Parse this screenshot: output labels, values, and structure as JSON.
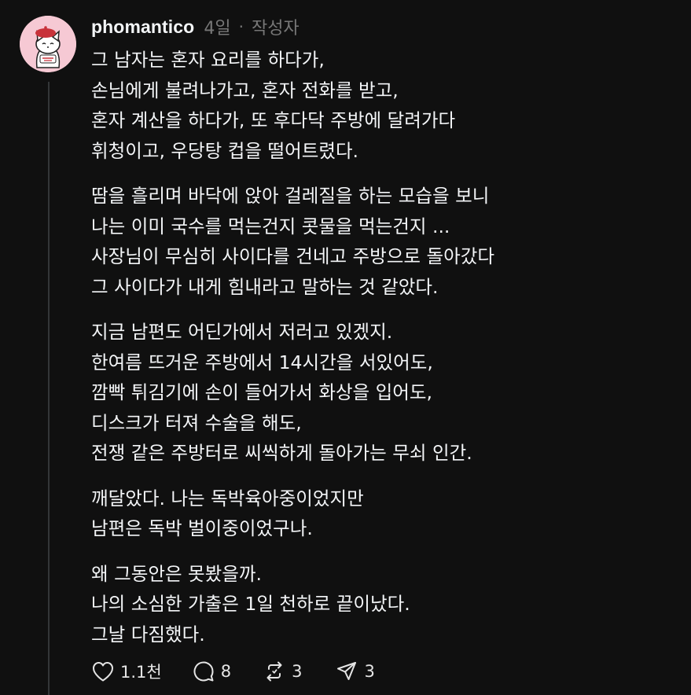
{
  "post": {
    "username": "phomantico",
    "time_ago": "4일",
    "separator": "·",
    "author_tag": "작성자",
    "avatar_icon": "cat-with-beret-avatar",
    "paragraphs": [
      {
        "lines": [
          "그 남자는 혼자 요리를 하다가,",
          "손님에게 불려나가고, 혼자 전화를 받고,",
          "혼자 계산을 하다가, 또 후다닥 주방에 달려가다",
          "휘청이고, 우당탕 컵을 떨어트렸다."
        ]
      },
      {
        "lines": [
          "땀을 흘리며 바닥에 앉아 걸레질을 하는 모습을 보니",
          "나는 이미 국수를 먹는건지 콧물을 먹는건지 ...",
          "사장님이 무심히 사이다를 건네고 주방으로 돌아갔다",
          "그 사이다가 내게 힘내라고 말하는 것 같았다."
        ]
      },
      {
        "lines": [
          "지금 남편도 어딘가에서 저러고 있겠지.",
          "한여름 뜨거운 주방에서 14시간을 서있어도,",
          "깜빡 튀김기에 손이 들어가서 화상을 입어도,",
          "디스크가 터져 수술을 해도,",
          "전쟁 같은 주방터로 씨씩하게 돌아가는 무쇠 인간."
        ]
      },
      {
        "lines": [
          "깨달았다. 나는 독박육아중이었지만",
          "남편은 독박 벌이중이었구나."
        ]
      },
      {
        "lines": [
          "왜 그동안은 못봤을까.",
          "나의 소심한 가출은 1일 천하로 끝이났다.",
          "그날 다짐했다."
        ]
      }
    ]
  },
  "actions": {
    "like_count": "1.1천",
    "reply_count": "8",
    "repost_count": "3",
    "share_count": "3",
    "icons": [
      "heart-icon",
      "comment-icon",
      "repost-icon",
      "share-icon"
    ]
  },
  "colors": {
    "background": "#101010",
    "text_primary": "#f3f5f7",
    "text_secondary": "#777777",
    "thread_line": "#333638",
    "avatar_bg": "#f6c9d4",
    "beret": "#c8323a"
  }
}
